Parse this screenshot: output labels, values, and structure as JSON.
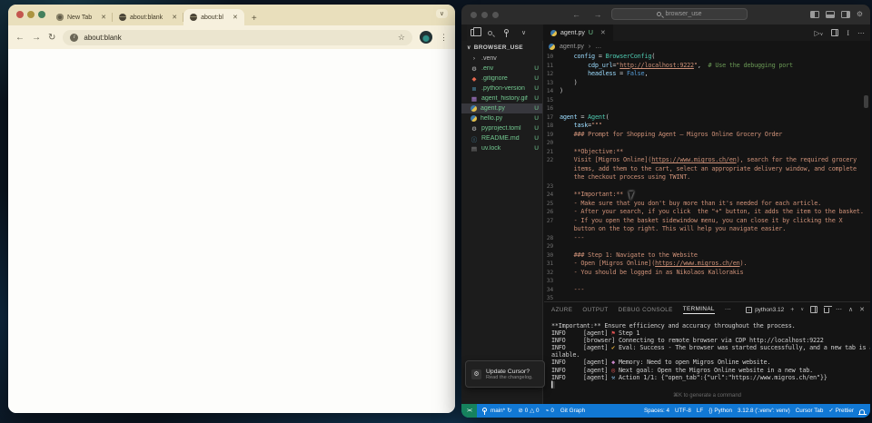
{
  "browser": {
    "tabs": [
      {
        "title": "New Tab",
        "icon": "chrome",
        "active": false
      },
      {
        "title": "about:blank",
        "icon": "globe",
        "active": false
      },
      {
        "title": "about:bl",
        "icon": "globe",
        "active": true
      }
    ],
    "new_tab_button": "+",
    "window_chevron": "∨",
    "nav": {
      "back": "←",
      "forward": "→",
      "reload": "↻"
    },
    "omnibox": {
      "url": "about:blank",
      "info_icon": "i",
      "star": "☆"
    },
    "menu_kebab": "⋮"
  },
  "vscode": {
    "titlebar": {
      "back": "←  →",
      "search_label": "browser_use"
    },
    "editor_tab": {
      "name": "agent.py",
      "git": "U",
      "close": "✕"
    },
    "editor_actions": {
      "run": "▷",
      "run_chev": "∨",
      "interactive": "I",
      "more": "⋯"
    },
    "breadcrumb": {
      "file": "agent.py",
      "sep": "›",
      "more": "…"
    },
    "sidebar": {
      "chevron": "∨",
      "header": "BROWSER_USE",
      "files": [
        {
          "name": ".venv",
          "icon": "folder",
          "badge": "",
          "selected": false,
          "untracked": false
        },
        {
          "name": ".env",
          "icon": "gear",
          "badge": "U",
          "selected": false,
          "untracked": true
        },
        {
          "name": ".gitignore",
          "icon": "git",
          "badge": "U",
          "selected": false,
          "untracked": true
        },
        {
          "name": ".python-version",
          "icon": "pyver",
          "badge": "U",
          "selected": false,
          "untracked": true
        },
        {
          "name": "agent_history.gif",
          "icon": "image",
          "badge": "U",
          "selected": false,
          "untracked": true
        },
        {
          "name": "agent.py",
          "icon": "python",
          "badge": "U",
          "selected": true,
          "untracked": true
        },
        {
          "name": "hello.py",
          "icon": "python",
          "badge": "U",
          "selected": false,
          "untracked": true
        },
        {
          "name": "pyproject.toml",
          "icon": "gear",
          "badge": "U",
          "selected": false,
          "untracked": true
        },
        {
          "name": "README.md",
          "icon": "info",
          "badge": "U",
          "selected": false,
          "untracked": true
        },
        {
          "name": "uv.lock",
          "icon": "file",
          "badge": "U",
          "selected": false,
          "untracked": true
        }
      ]
    },
    "editor": {
      "rows": [
        {
          "n": "10",
          "s": [
            [
              "    ",
              "d"
            ],
            [
              "config",
              "v"
            ],
            [
              " = ",
              "d"
            ],
            [
              "BrowserConfig",
              "c"
            ],
            [
              "(",
              "d"
            ]
          ]
        },
        {
          "n": "11",
          "s": [
            [
              "        ",
              "d"
            ],
            [
              "cdp_url",
              "v"
            ],
            [
              "=",
              "d"
            ],
            [
              "\"",
              "s"
            ],
            [
              "http://localhost:9222",
              "l"
            ],
            [
              "\"",
              "s"
            ],
            [
              ",  ",
              "d"
            ],
            [
              "# Use the debugging port",
              "m"
            ]
          ]
        },
        {
          "n": "12",
          "s": [
            [
              "        ",
              "d"
            ],
            [
              "headless",
              "v"
            ],
            [
              " = ",
              "d"
            ],
            [
              "False",
              "k"
            ],
            [
              ",",
              "d"
            ]
          ]
        },
        {
          "n": "13",
          "s": [
            [
              "    )",
              "d"
            ]
          ]
        },
        {
          "n": "14",
          "s": [
            [
              ")",
              "d"
            ]
          ]
        },
        {
          "n": "15",
          "s": []
        },
        {
          "n": "16",
          "s": []
        },
        {
          "n": "17",
          "s": [
            [
              "agent",
              "v"
            ],
            [
              " = ",
              "d"
            ],
            [
              "Agent",
              "c"
            ],
            [
              "(",
              "d"
            ]
          ]
        },
        {
          "n": "18",
          "s": [
            [
              "    ",
              "d"
            ],
            [
              "task",
              "v"
            ],
            [
              "=",
              "d"
            ],
            [
              "\"\"\"",
              "s"
            ]
          ]
        },
        {
          "n": "19",
          "s": [
            [
              "    ### Prompt for Shopping Agent – Migros Online Grocery Order",
              "s"
            ]
          ]
        },
        {
          "n": "20",
          "s": []
        },
        {
          "n": "21",
          "s": [
            [
              "    **Objective:**",
              "s"
            ]
          ]
        },
        {
          "n": "22",
          "s": [
            [
              "    Visit [Migros Online](",
              "s"
            ],
            [
              "https://www.migros.ch/en",
              "l"
            ],
            [
              "), search for the required grocery",
              "s"
            ]
          ]
        },
        {
          "n": "",
          "s": [
            [
              "    items, add them to the cart, select an appropriate delivery window, and complete",
              "s"
            ]
          ]
        },
        {
          "n": "",
          "s": [
            [
              "    the checkout process using TWINT.",
              "s"
            ]
          ]
        },
        {
          "n": "23",
          "s": []
        },
        {
          "n": "24",
          "s": [
            [
              "    **Important:**",
              "s"
            ]
          ]
        },
        {
          "n": "25",
          "s": [
            [
              "    - Make sure that you don't buy more than it's needed for each article.",
              "s"
            ]
          ]
        },
        {
          "n": "26",
          "s": [
            [
              "    - After your search, if you click  the \"+\" button, it adds the item to the basket.",
              "s"
            ]
          ]
        },
        {
          "n": "27",
          "s": [
            [
              "    - If you open the basket sidewindow menu, you can close it by clicking the X",
              "s"
            ]
          ]
        },
        {
          "n": "",
          "s": [
            [
              "    button on the top right. This will help you navigate easier.",
              "s"
            ]
          ]
        },
        {
          "n": "28",
          "s": [
            [
              "    ---",
              "s"
            ]
          ]
        },
        {
          "n": "29",
          "s": []
        },
        {
          "n": "30",
          "s": [
            [
              "    ### Step 1: Navigate to the Website",
              "s"
            ]
          ]
        },
        {
          "n": "31",
          "s": [
            [
              "    - Open [Migros Online](",
              "s"
            ],
            [
              "https://www.migros.ch/en",
              "l"
            ],
            [
              ").",
              "s"
            ]
          ]
        },
        {
          "n": "32",
          "s": [
            [
              "    - You should be logged in as Nikolaos Kallorakis",
              "s"
            ]
          ]
        },
        {
          "n": "33",
          "s": []
        },
        {
          "n": "34",
          "s": [
            [
              "    ---",
              "s"
            ]
          ]
        },
        {
          "n": "35",
          "s": []
        }
      ]
    },
    "panel": {
      "tabs": [
        {
          "label": "AZURE",
          "active": false
        },
        {
          "label": "OUTPUT",
          "active": false
        },
        {
          "label": "DEBUG CONSOLE",
          "active": false
        },
        {
          "label": "TERMINAL",
          "active": true
        }
      ],
      "more": "⋯",
      "shell": "python3.12",
      "actions": {
        "add": "+",
        "chev": "∨",
        "more": "⋯",
        "up": "∧",
        "close": "✕"
      },
      "hint": "⌘K to generate a command"
    },
    "terminal": {
      "lines": [
        {
          "s": [
            [
              "**Important:** Ensure efficiency and accuracy throughout the process.",
              "t"
            ]
          ]
        },
        {
          "s": [
            [
              "INFO     [agent] ",
              "t"
            ],
            [
              "⚑",
              "red"
            ],
            [
              " Step 1",
              "t"
            ]
          ]
        },
        {
          "s": [
            [
              "INFO     [browser] Connecting to remote browser via CDP http://localhost:9222",
              "t"
            ]
          ]
        },
        {
          "s": [
            [
              "INFO     [agent] ",
              "t"
            ],
            [
              "✔",
              "yel"
            ],
            [
              " Eval: Success - The browser was started successfully, and a new tab is av",
              "t"
            ]
          ]
        },
        {
          "s": [
            [
              "ailable.",
              "t"
            ]
          ]
        },
        {
          "s": [
            [
              "INFO     [agent] ",
              "t"
            ],
            [
              "◆",
              "pink"
            ],
            [
              " Memory: Need to open Migros Online website.",
              "t"
            ]
          ]
        },
        {
          "s": [
            [
              "INFO     [agent] ",
              "t"
            ],
            [
              "◎",
              "red"
            ],
            [
              " Next goal: Open the Migros Online website in a new tab.",
              "t"
            ]
          ]
        },
        {
          "s": [
            [
              "INFO     [agent] ",
              "t"
            ],
            [
              "⚒",
              "blu"
            ],
            [
              " Action 1/1: {\"open_tab\":{\"url\":\"https://www.migros.ch/en\"}}",
              "t"
            ]
          ]
        },
        {
          "s": [
            [
              "▍",
              "cur"
            ]
          ]
        }
      ]
    },
    "statusbar": {
      "remote": "><",
      "branch": "main*",
      "sync": "↻",
      "problems_icon": "⊘",
      "problems": "0",
      "warnings_icon": "△",
      "warnings": "0",
      "broadcast_icon": "⌁",
      "broadcast": "0",
      "git_graph": "Git Graph",
      "spaces": "Spaces: 4",
      "encoding": "UTF-8",
      "eol": "LF",
      "language_icon": "{}",
      "language": "Python",
      "interpreter": "3.12.8 ('.venv': venv)",
      "cursor_tab": "Cursor Tab",
      "formatter_icon": "✓",
      "formatter": "Prettier"
    },
    "notification": {
      "title": "Update Cursor?",
      "body": "Read the changelog."
    }
  },
  "colors": {
    "status_bar": "#1178d4",
    "remote_green": "#16825d",
    "untracked_green": "#73c991",
    "chrome_tabstrip": "#e9dfbc",
    "chrome_toolbar": "#f6f0dd",
    "string_orange": "#ce9178"
  }
}
